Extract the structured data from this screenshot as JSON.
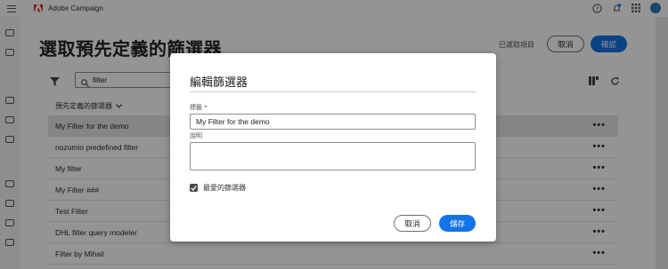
{
  "app": {
    "name": "Adobe Campaign"
  },
  "dialog": {
    "title": "選取預先定義的篩選器",
    "selected_items_label": "已選取項目",
    "cancel_label": "取消",
    "confirm_label": "確認",
    "search": {
      "value": "filter"
    },
    "dropdown_label": "預先定義的篩選器",
    "rows": [
      {
        "name": "My Filter for the demo",
        "highlighted": true
      },
      {
        "name": "nozomio predefined filter"
      },
      {
        "name": "My filter"
      },
      {
        "name": "My Filter ###"
      },
      {
        "name": "Test Filter"
      },
      {
        "name": "DHL filter query modeler"
      },
      {
        "name": "Filter by Mihail"
      }
    ],
    "row_more_label": "•••"
  },
  "modal": {
    "title": "編輯篩選器",
    "title_label": "標籤 *",
    "title_value": "My Filter  for the demo",
    "description_label": "說明",
    "description_value": "",
    "favorite_label": "最愛的篩選器",
    "favorite_checked": true,
    "cancel_label": "取消",
    "save_label": "儲存"
  },
  "colors": {
    "primary": "#1473e6",
    "overlay": "rgba(0,0,0,0.42)"
  }
}
